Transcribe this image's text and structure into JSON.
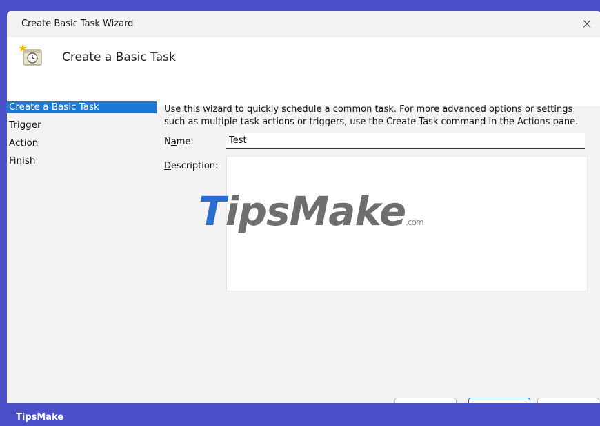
{
  "window": {
    "title": "Create Basic Task Wizard",
    "close_icon": "close-icon"
  },
  "header": {
    "title": "Create a Basic Task",
    "icon": "clock-task-icon"
  },
  "steps": [
    {
      "label": "Create a Basic Task",
      "active": true
    },
    {
      "label": "Trigger",
      "active": false
    },
    {
      "label": "Action",
      "active": false
    },
    {
      "label": "Finish",
      "active": false
    }
  ],
  "main": {
    "intro_line1": "Use this wizard to quickly schedule a common task.  For more advanced options or settings",
    "intro_line2": "such as multiple task actions or triggers, use the Create Task command in the Actions pane.",
    "name_label_pre": "N",
    "name_label_accel": "a",
    "name_label_post": "me:",
    "name_value": "Test",
    "description_label_accel": "D",
    "description_label_post": "escription:",
    "description_value": ""
  },
  "watermark": {
    "t": "T",
    "rest": "ipsMake",
    "com": ".com"
  },
  "footer": {
    "brand": "TipsMake"
  },
  "colors": {
    "accent": "#1c78d4",
    "frame": "#4a4fc8"
  }
}
